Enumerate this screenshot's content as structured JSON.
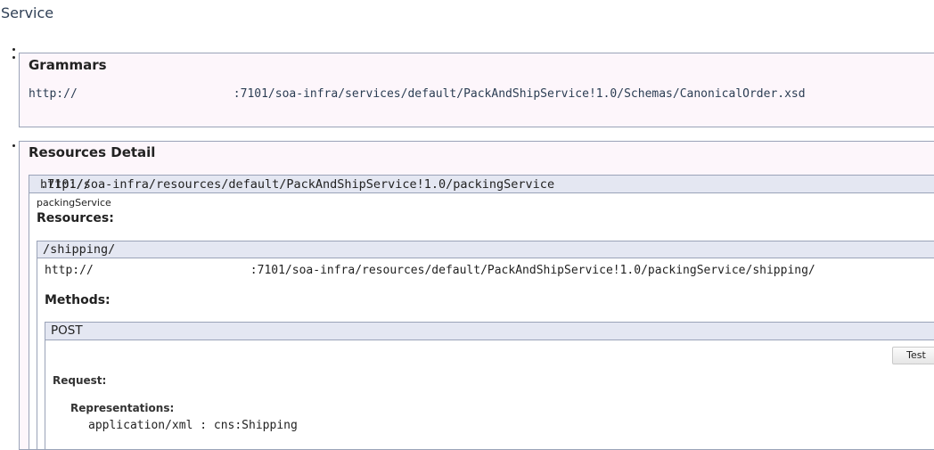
{
  "page": {
    "title": "Service"
  },
  "grammars": {
    "heading": "Grammars",
    "url_prefix": "http://",
    "url_suffix": ":7101/soa-infra/services/default/PackAndShipService!1.0/Schemas/CanonicalOrder.xsd"
  },
  "resources_detail": {
    "heading": "Resources Detail",
    "resource": {
      "url_prefix": "http://",
      "url_suffix": ".7101/soa-infra/resources/default/PackAndShipService!1.0/packingService",
      "name": "packingService",
      "resources_label": "Resources:",
      "sub": {
        "path": "/shipping/",
        "url_prefix": "http://",
        "url_suffix": ":7101/soa-infra/resources/default/PackAndShipService!1.0/packingService/shipping/",
        "methods_label": "Methods:",
        "method": {
          "name": "POST",
          "test_button": "Test",
          "request_label": "Request:",
          "representations_label": "Representations:",
          "representation": "application/xml : cns:Shipping"
        }
      }
    }
  }
}
